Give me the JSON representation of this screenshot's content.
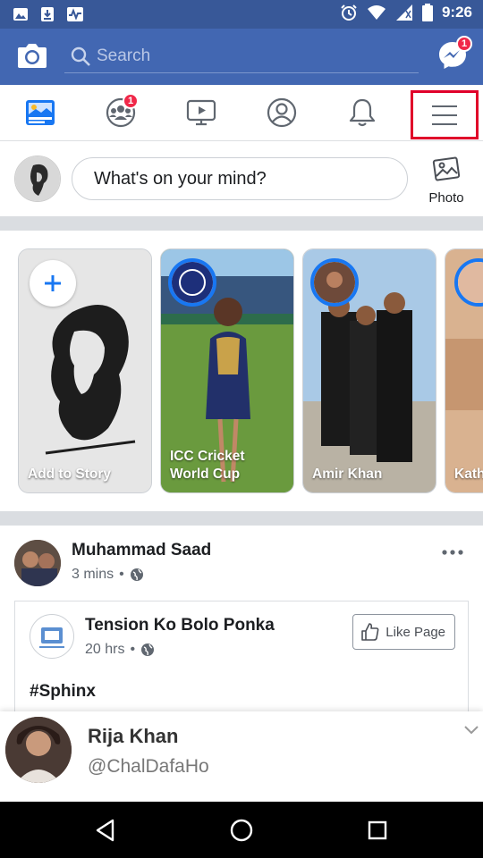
{
  "status_bar": {
    "time": "9:26"
  },
  "header": {
    "search_placeholder": "Search",
    "messenger_badge": "1"
  },
  "tabs": [
    {
      "name": "news-feed",
      "icon": "news-feed-icon"
    },
    {
      "name": "groups",
      "icon": "groups-icon",
      "badge": "1"
    },
    {
      "name": "watch",
      "icon": "watch-video-icon"
    },
    {
      "name": "profile",
      "icon": "profile-icon"
    },
    {
      "name": "notifications",
      "icon": "bell-icon"
    },
    {
      "name": "menu",
      "icon": "hamburger-menu-icon"
    }
  ],
  "composer": {
    "placeholder": "What's on your mind?",
    "photo_label": "Photo"
  },
  "stories": [
    {
      "label": "Add to Story"
    },
    {
      "label": "ICC Cricket World Cup"
    },
    {
      "label": "Amir Khan"
    },
    {
      "label": "Kath"
    }
  ],
  "post": {
    "author": "Muhammad Saad",
    "time": "3 mins",
    "shared": {
      "page_name": "Tension Ko Bolo Ponka",
      "time": "20 hrs",
      "like_button": "Like Page",
      "text": "#Sphinx"
    }
  },
  "overlay": {
    "name": "Rija Khan",
    "handle": "@ChalDafaHo"
  },
  "colors": {
    "header_blue": "#4267b2",
    "statusbar_blue": "#385898",
    "badge_red": "#f02849",
    "highlight_red": "#e0002a",
    "story_ring": "#1877f2"
  }
}
